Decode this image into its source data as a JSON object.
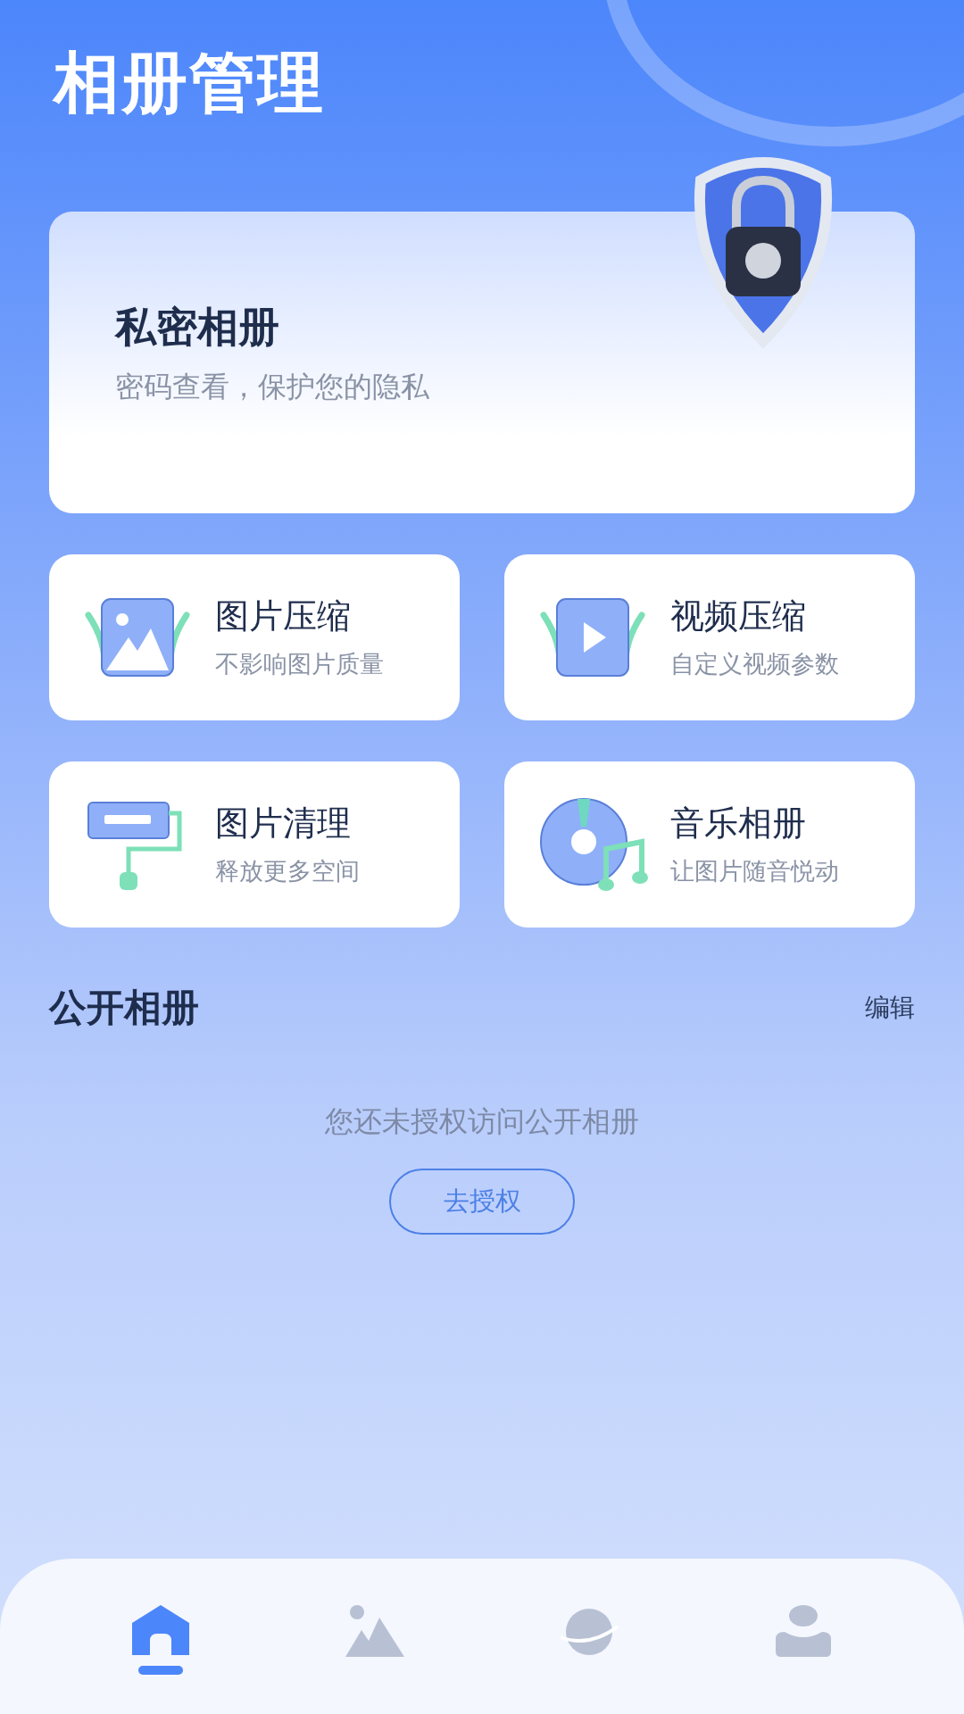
{
  "title": "相册管理",
  "private_card": {
    "title": "私密相册",
    "subtitle": "密码查看，保护您的隐私"
  },
  "features": [
    {
      "kind": "image",
      "title": "图片压缩",
      "subtitle": "不影响图片质量"
    },
    {
      "kind": "video",
      "title": "视频压缩",
      "subtitle": "自定义视频参数"
    },
    {
      "kind": "cleaner",
      "title": "图片清理",
      "subtitle": "释放更多空间"
    },
    {
      "kind": "music",
      "title": "音乐相册",
      "subtitle": "让图片随音悦动"
    }
  ],
  "public_section": {
    "title": "公开相册",
    "action": "编辑",
    "empty_text": "您还未授权访问公开相册",
    "button": "去授权"
  },
  "nav": [
    {
      "kind": "home",
      "selected": true
    },
    {
      "kind": "gallery",
      "selected": false
    },
    {
      "kind": "planet",
      "selected": false
    },
    {
      "kind": "profile",
      "selected": false
    }
  ]
}
